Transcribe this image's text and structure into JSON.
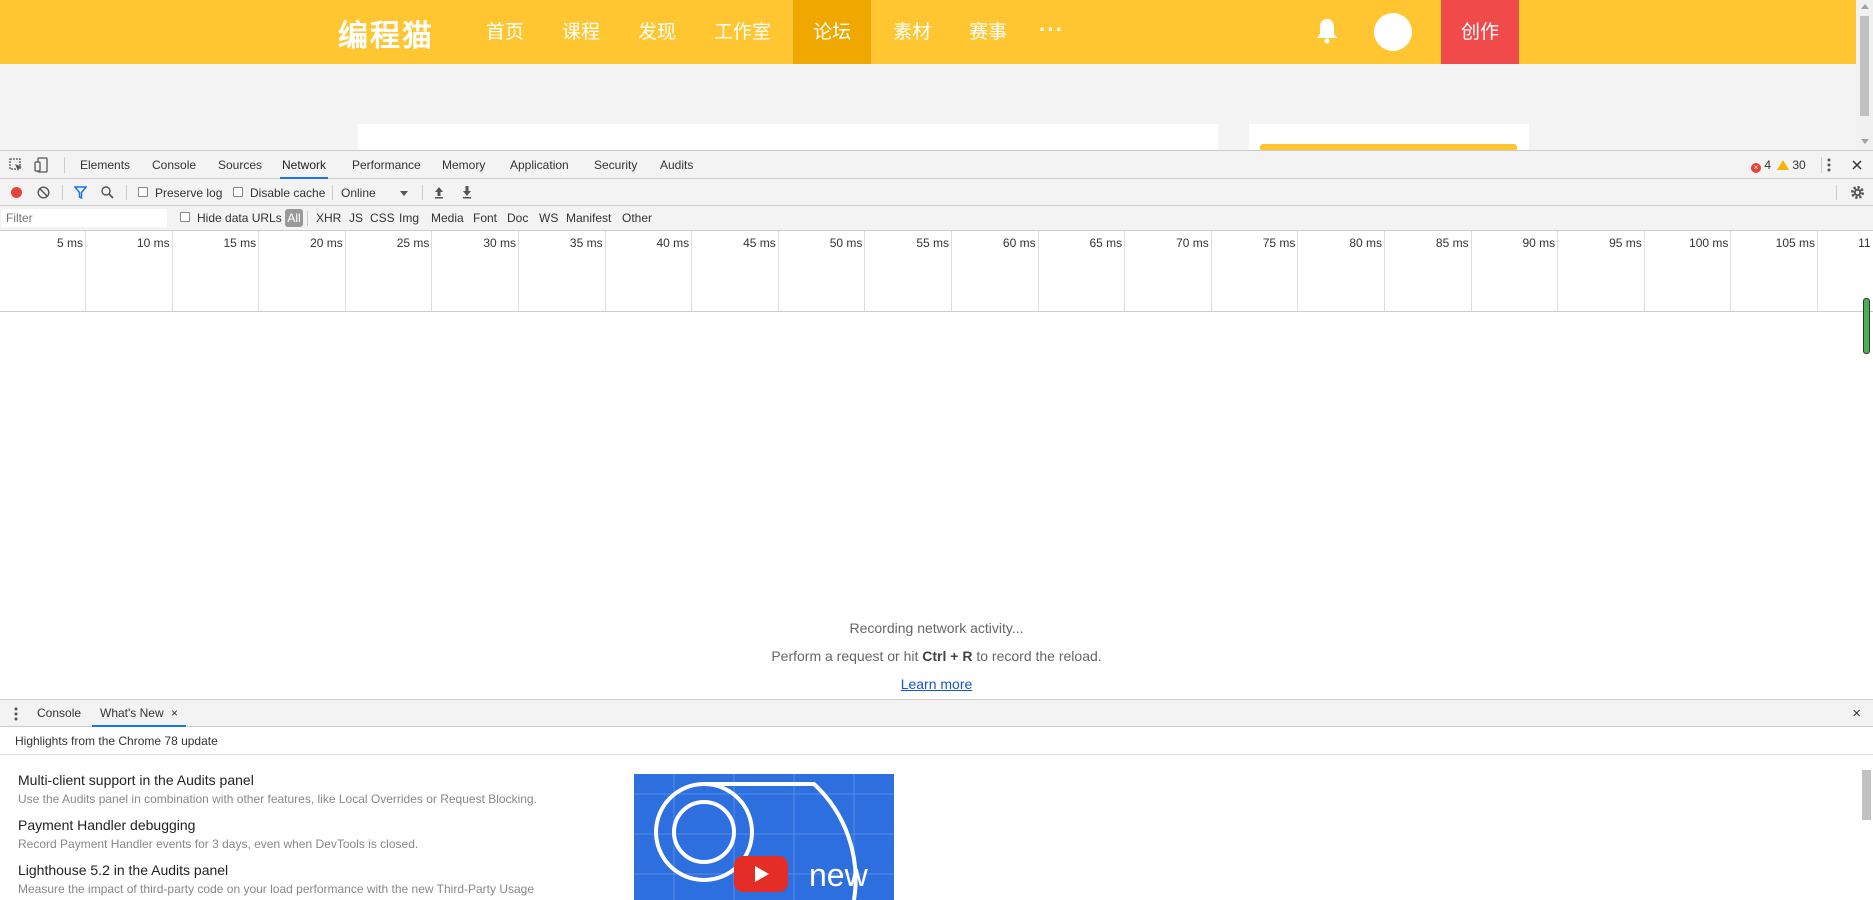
{
  "site": {
    "logo": "编程猫",
    "nav": [
      "首页",
      "课程",
      "发现",
      "工作室",
      "论坛",
      "素材",
      "赛事"
    ],
    "active_nav": "论坛",
    "more": "···",
    "create_label": "创作",
    "colors": {
      "header": "#ffc632",
      "active": "#f0a800",
      "create": "#f04a4a"
    }
  },
  "devtools": {
    "tabs": [
      "Elements",
      "Console",
      "Sources",
      "Network",
      "Performance",
      "Memory",
      "Application",
      "Security",
      "Audits"
    ],
    "active_tab": "Network",
    "errors": "4",
    "warnings": "30",
    "toolbar": {
      "preserve_log": "Preserve log",
      "disable_cache": "Disable cache",
      "throttle": "Online"
    },
    "filter": {
      "placeholder": "Filter",
      "hide_data_urls": "Hide data URLs",
      "all": "All",
      "types": [
        "XHR",
        "JS",
        "CSS",
        "Img",
        "Media",
        "Font",
        "Doc",
        "WS",
        "Manifest",
        "Other"
      ]
    },
    "timeline_ticks": [
      "5 ms",
      "10 ms",
      "15 ms",
      "20 ms",
      "25 ms",
      "30 ms",
      "35 ms",
      "40 ms",
      "45 ms",
      "50 ms",
      "55 ms",
      "60 ms",
      "65 ms",
      "70 ms",
      "75 ms",
      "80 ms",
      "85 ms",
      "90 ms",
      "95 ms",
      "100 ms",
      "105 ms",
      "11"
    ],
    "empty": {
      "line1": "Recording network activity...",
      "line2_pre": "Perform a request or hit ",
      "line2_keys": "Ctrl + R",
      "line2_post": " to record the reload.",
      "learn_more": "Learn more"
    },
    "drawer": {
      "tabs": [
        "Console",
        "What's New"
      ],
      "active": "What's New",
      "heading": "Highlights from the Chrome 78 update",
      "features": [
        {
          "title": "Multi-client support in the Audits panel",
          "desc": "Use the Audits panel in combination with other features, like Local Overrides or Request Blocking."
        },
        {
          "title": "Payment Handler debugging",
          "desc": "Record Payment Handler events for 3 days, even when DevTools is closed."
        },
        {
          "title": "Lighthouse 5.2 in the Audits panel",
          "desc": "Measure the impact of third-party code on your load performance with the new Third-Party Usage"
        }
      ],
      "video_text": "new"
    }
  }
}
